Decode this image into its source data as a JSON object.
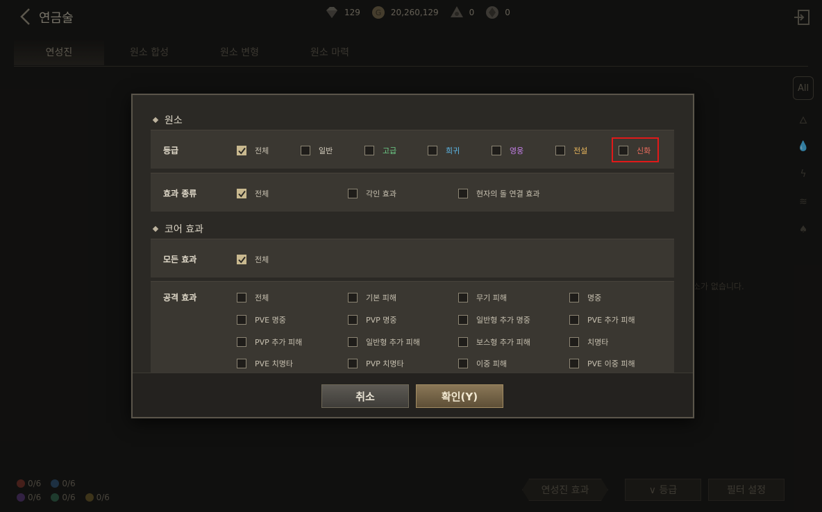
{
  "header": {
    "title": "연금술",
    "currencies": [
      {
        "icon": "diamond-icon",
        "value": "129"
      },
      {
        "icon": "gold-coin-icon",
        "value": "20,260,129"
      },
      {
        "icon": "crystal-a-icon",
        "value": "0"
      },
      {
        "icon": "crystal-b-icon",
        "value": "0"
      }
    ]
  },
  "tabs": [
    "연성진",
    "원소 합성",
    "원소 변형",
    "원소 마력"
  ],
  "right_filter": {
    "all_label": "All"
  },
  "background_hint": "소가 없습니다.",
  "element_status": {
    "row1": [
      "0/6",
      "0/6"
    ],
    "row2": [
      "0/6",
      "0/6",
      "0/6"
    ]
  },
  "bottom_buttons": {
    "circle_effect": "연성진 효과",
    "grade": "∨ 등급",
    "filter": "필터 설정"
  },
  "modal": {
    "section_element": "원소",
    "grade": {
      "label": "등급",
      "options": [
        {
          "text": "전체",
          "checked": true
        },
        {
          "text": "일반",
          "checked": false
        },
        {
          "text": "고급",
          "checked": false
        },
        {
          "text": "희귀",
          "checked": false
        },
        {
          "text": "영웅",
          "checked": false
        },
        {
          "text": "전설",
          "checked": false
        },
        {
          "text": "신화",
          "checked": false
        }
      ]
    },
    "effect_type": {
      "label": "효과 종류",
      "options": [
        {
          "text": "전체",
          "checked": true
        },
        {
          "text": "각인 효과",
          "checked": false
        },
        {
          "text": "현자의 돌 연결 효과",
          "checked": false
        }
      ]
    },
    "section_core": "코어 효과",
    "all_effects": {
      "label": "모든 효과",
      "options": [
        {
          "text": "전체",
          "checked": true
        }
      ]
    },
    "attack_effects": {
      "label": "공격 효과",
      "options": [
        "전체",
        "기본 피해",
        "무기 피해",
        "명중",
        "PVE 명중",
        "PVP 명중",
        "일반형 추가 명중",
        "PVE 추가 피해",
        "PVP 추가 피해",
        "일반형 추가 피해",
        "보스형 추가 피해",
        "치명타",
        "PVE 치명타",
        "PVP 치명타",
        "이중 피해",
        "PVE 이중 피해"
      ]
    },
    "cancel": "취소",
    "confirm": "확인(Y)"
  },
  "colors": {
    "general": "#d8d1c1",
    "advanced": "#6fd08a",
    "rare": "#5db8e8",
    "hero": "#c27ee6",
    "legend": "#e8b65c",
    "myth": "#ee6d5e"
  }
}
